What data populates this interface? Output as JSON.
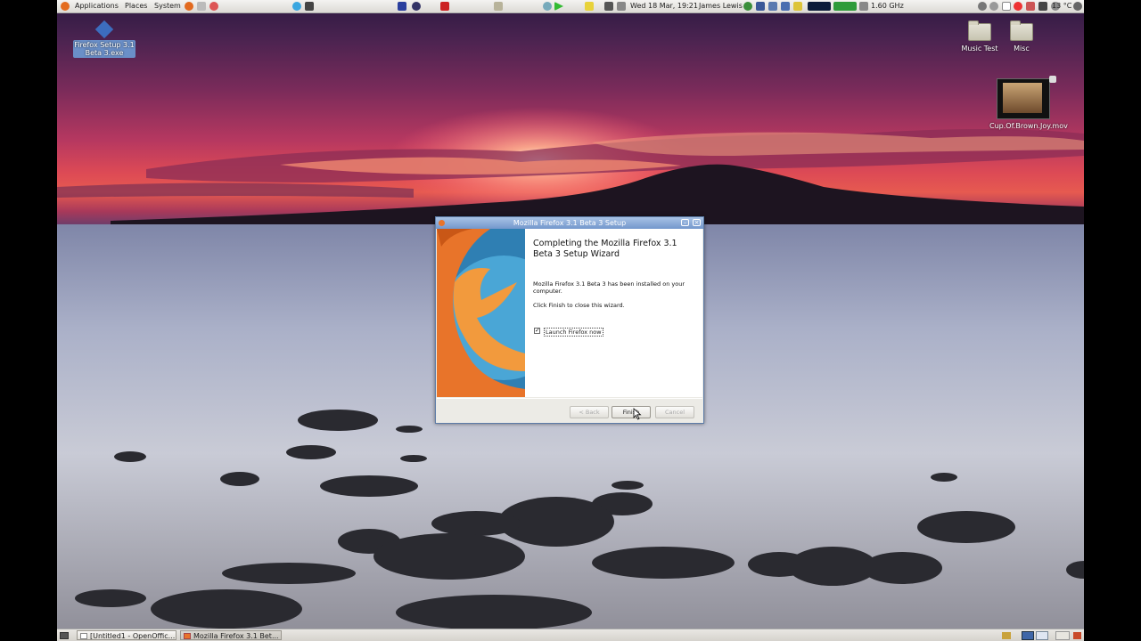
{
  "top_panel": {
    "menus": [
      "Applications",
      "Places",
      "System"
    ],
    "clock": "Wed 18 Mar, 19:21",
    "user": "James Lewis",
    "cpu_freq": "1.60 GHz",
    "weather": "13 °C"
  },
  "desktop_icons": {
    "installer": "Firefox Setup 3.1 Beta 3.exe",
    "folder_music": "Music Test",
    "folder_misc": "Misc",
    "video": "Cup.Of.Brown.Joy.mov"
  },
  "dialog": {
    "title": "Mozilla Firefox 3.1 Beta 3 Setup",
    "heading": "Completing the Mozilla Firefox 3.1 Beta 3 Setup Wizard",
    "installed_text": "Mozilla Firefox 3.1 Beta 3 has been installed on your computer.",
    "finish_hint": "Click Finish to close this wizard.",
    "launch_label": "Launch Firefox now",
    "launch_checked": true,
    "back_label": "< Back",
    "finish_label": "Finish",
    "cancel_label": "Cancel"
  },
  "taskbar": {
    "tasks": [
      "[Untitled1 - OpenOffic...",
      "Mozilla Firefox 3.1 Bet..."
    ]
  },
  "colors": {
    "titlebar": "#7397cc",
    "panel": "#dcdad5",
    "firefox_orange": "#e8742a",
    "globe_blue": "#3a8fc0"
  }
}
